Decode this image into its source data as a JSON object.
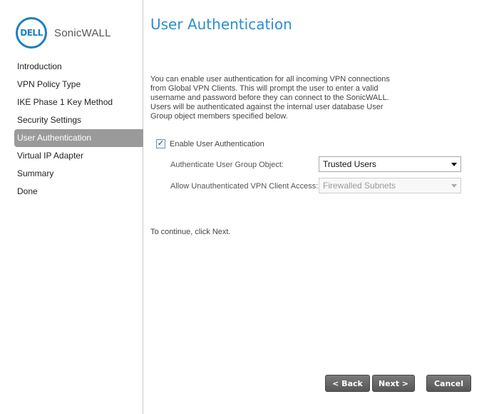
{
  "brand": {
    "badge_text": "DELL",
    "product_name": "SonicWALL",
    "accent_color": "#1f7fc1"
  },
  "nav": {
    "items": [
      {
        "label": "Introduction"
      },
      {
        "label": "VPN Policy Type"
      },
      {
        "label": "IKE Phase 1 Key Method"
      },
      {
        "label": "Security Settings"
      },
      {
        "label": "User Authentication",
        "active": true
      },
      {
        "label": "Virtual IP Adapter"
      },
      {
        "label": "Summary"
      },
      {
        "label": "Done"
      }
    ]
  },
  "page": {
    "title": "User Authentication",
    "title_color": "#2a8fd0",
    "description": "You can enable user authentication for all incoming VPN connections from Global VPN Clients. This will prompt the user to enter a valid username and password before they can connect to the SonicWALL. Users will be authenticated against the internal user database User Group object members specified below.",
    "enable_auth": {
      "label": "Enable User Authentication",
      "checked": true
    },
    "user_group": {
      "label": "Authenticate User Group Object:",
      "value": "Trusted Users"
    },
    "unauth_access": {
      "label": "Allow Unauthenticated VPN Client Access:",
      "value": "Firewalled Subnets",
      "disabled": true
    },
    "continue_text": "To continue, click Next."
  },
  "buttons": {
    "back": "< Back",
    "next": "Next >",
    "cancel": "Cancel"
  }
}
